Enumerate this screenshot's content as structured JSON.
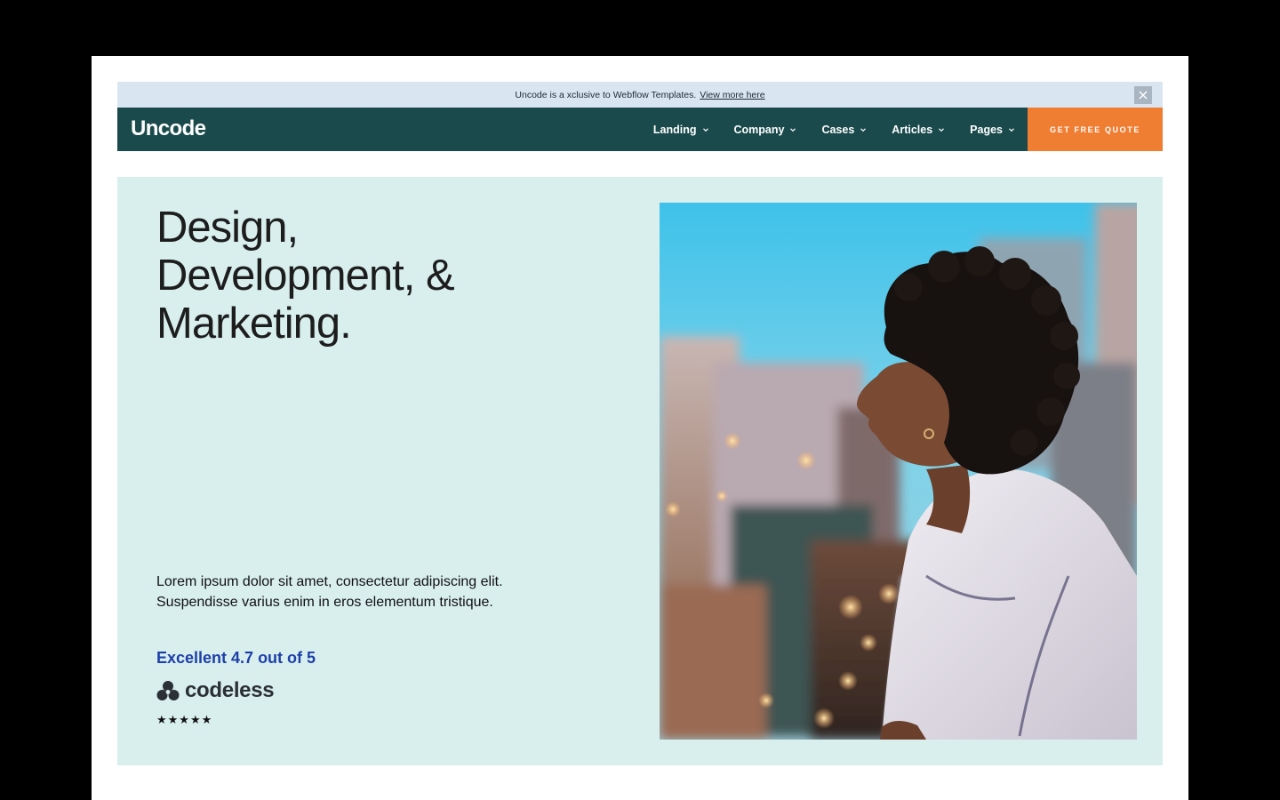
{
  "announcement": {
    "text": "Uncode is a xclusive to Webflow Templates.",
    "link": "View more here"
  },
  "navbar": {
    "logo": "Uncode",
    "items": [
      {
        "label": "Landing"
      },
      {
        "label": "Company"
      },
      {
        "label": "Cases"
      },
      {
        "label": "Articles"
      },
      {
        "label": "Pages"
      }
    ],
    "cta": "GET FREE QUOTE"
  },
  "hero": {
    "headline_lines": [
      "Design,",
      "Development, &",
      "Marketing."
    ],
    "description_lines": [
      "Lorem ipsum dolor sit amet, consectetur adipiscing elit.",
      "Suspendisse varius enim in eros elementum tristique."
    ],
    "rating_text": "Excellent 4.7 out of 5",
    "brand": "codeless",
    "stars": "★★★★★",
    "star_rating": 5,
    "image_subject": "woman-on-rooftop-photo"
  },
  "colors": {
    "navbar_bg": "#1a4a4c",
    "cta_bg": "#ef7d32",
    "hero_bg": "#d8efee",
    "announce_bg": "#dae5f2",
    "rating_text": "#1e3fa8"
  }
}
